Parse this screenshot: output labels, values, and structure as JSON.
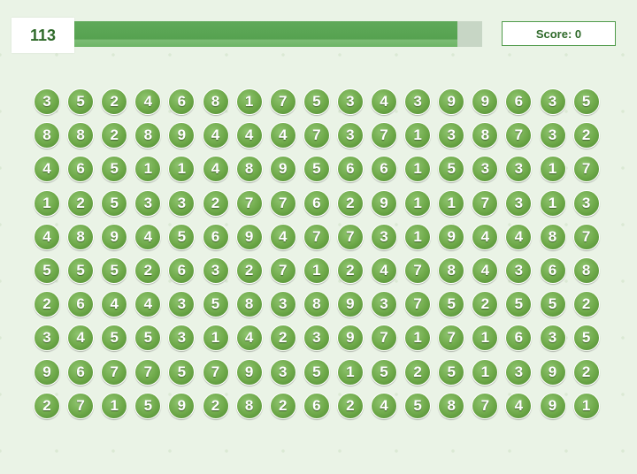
{
  "hud": {
    "timer": "113",
    "score_label": "Score: 0",
    "progress": 0.94
  },
  "colors": {
    "ball": "#6da848",
    "progress_fill": "#56a250",
    "background": "#eaf3e6"
  },
  "board": [
    [
      3,
      5,
      2,
      4,
      6,
      8,
      1,
      7,
      5,
      3,
      4,
      3,
      9,
      9,
      6,
      3,
      5
    ],
    [
      8,
      8,
      2,
      8,
      9,
      4,
      4,
      4,
      7,
      3,
      7,
      1,
      3,
      8,
      7,
      3,
      2
    ],
    [
      4,
      6,
      5,
      1,
      1,
      4,
      8,
      9,
      5,
      6,
      6,
      1,
      5,
      3,
      3,
      1,
      7
    ],
    [
      1,
      2,
      5,
      3,
      3,
      2,
      7,
      7,
      6,
      2,
      9,
      1,
      1,
      7,
      3,
      1,
      3
    ],
    [
      4,
      8,
      9,
      4,
      5,
      6,
      9,
      4,
      7,
      7,
      3,
      1,
      9,
      4,
      4,
      8,
      7
    ],
    [
      5,
      5,
      5,
      2,
      6,
      3,
      2,
      7,
      1,
      2,
      4,
      7,
      8,
      4,
      3,
      6,
      8
    ],
    [
      2,
      6,
      4,
      4,
      3,
      5,
      8,
      3,
      8,
      9,
      3,
      7,
      5,
      2,
      5,
      5,
      2
    ],
    [
      3,
      4,
      5,
      5,
      3,
      1,
      4,
      2,
      3,
      9,
      7,
      1,
      7,
      1,
      6,
      3,
      5
    ],
    [
      9,
      6,
      7,
      7,
      5,
      7,
      9,
      3,
      5,
      1,
      5,
      2,
      5,
      1,
      3,
      9,
      2
    ],
    [
      2,
      7,
      1,
      5,
      9,
      2,
      8,
      2,
      6,
      2,
      4,
      5,
      8,
      7,
      4,
      9,
      1
    ]
  ]
}
